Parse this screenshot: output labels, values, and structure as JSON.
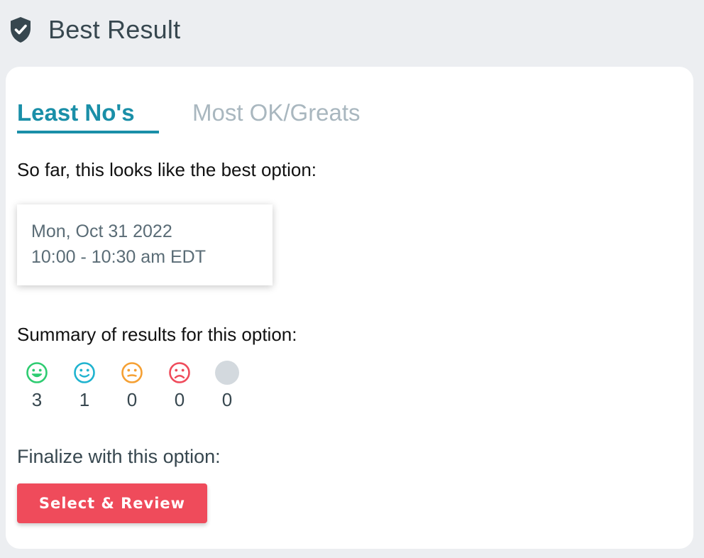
{
  "header": {
    "title": "Best Result",
    "icon": "shield-check-icon"
  },
  "tabs": [
    {
      "label": "Least No's",
      "active": true
    },
    {
      "label": "Most OK/Greats",
      "active": false
    }
  ],
  "intro_text": "So far, this looks like the best option:",
  "best_option": {
    "date": "Mon, Oct 31 2022",
    "time": "10:00 - 10:30 am EDT"
  },
  "summary": {
    "label": "Summary of results for this option:",
    "votes": [
      {
        "icon": "big-smile-icon",
        "color": "#2ecc71",
        "count": "3"
      },
      {
        "icon": "smile-icon",
        "color": "#1fb3cf",
        "count": "1"
      },
      {
        "icon": "neutral-face-icon",
        "color": "#f5a033",
        "count": "0"
      },
      {
        "icon": "frown-icon",
        "color": "#ef4b5b",
        "count": "0"
      },
      {
        "icon": "no-response-icon",
        "color": "#d3d9de",
        "count": "0"
      }
    ]
  },
  "finalize": {
    "label": "Finalize with this option:",
    "button_label": "Select & Review",
    "button_color": "#ef4b5b"
  },
  "colors": {
    "accent": "#1a8fa8",
    "background": "#eceef1",
    "card": "#ffffff"
  }
}
